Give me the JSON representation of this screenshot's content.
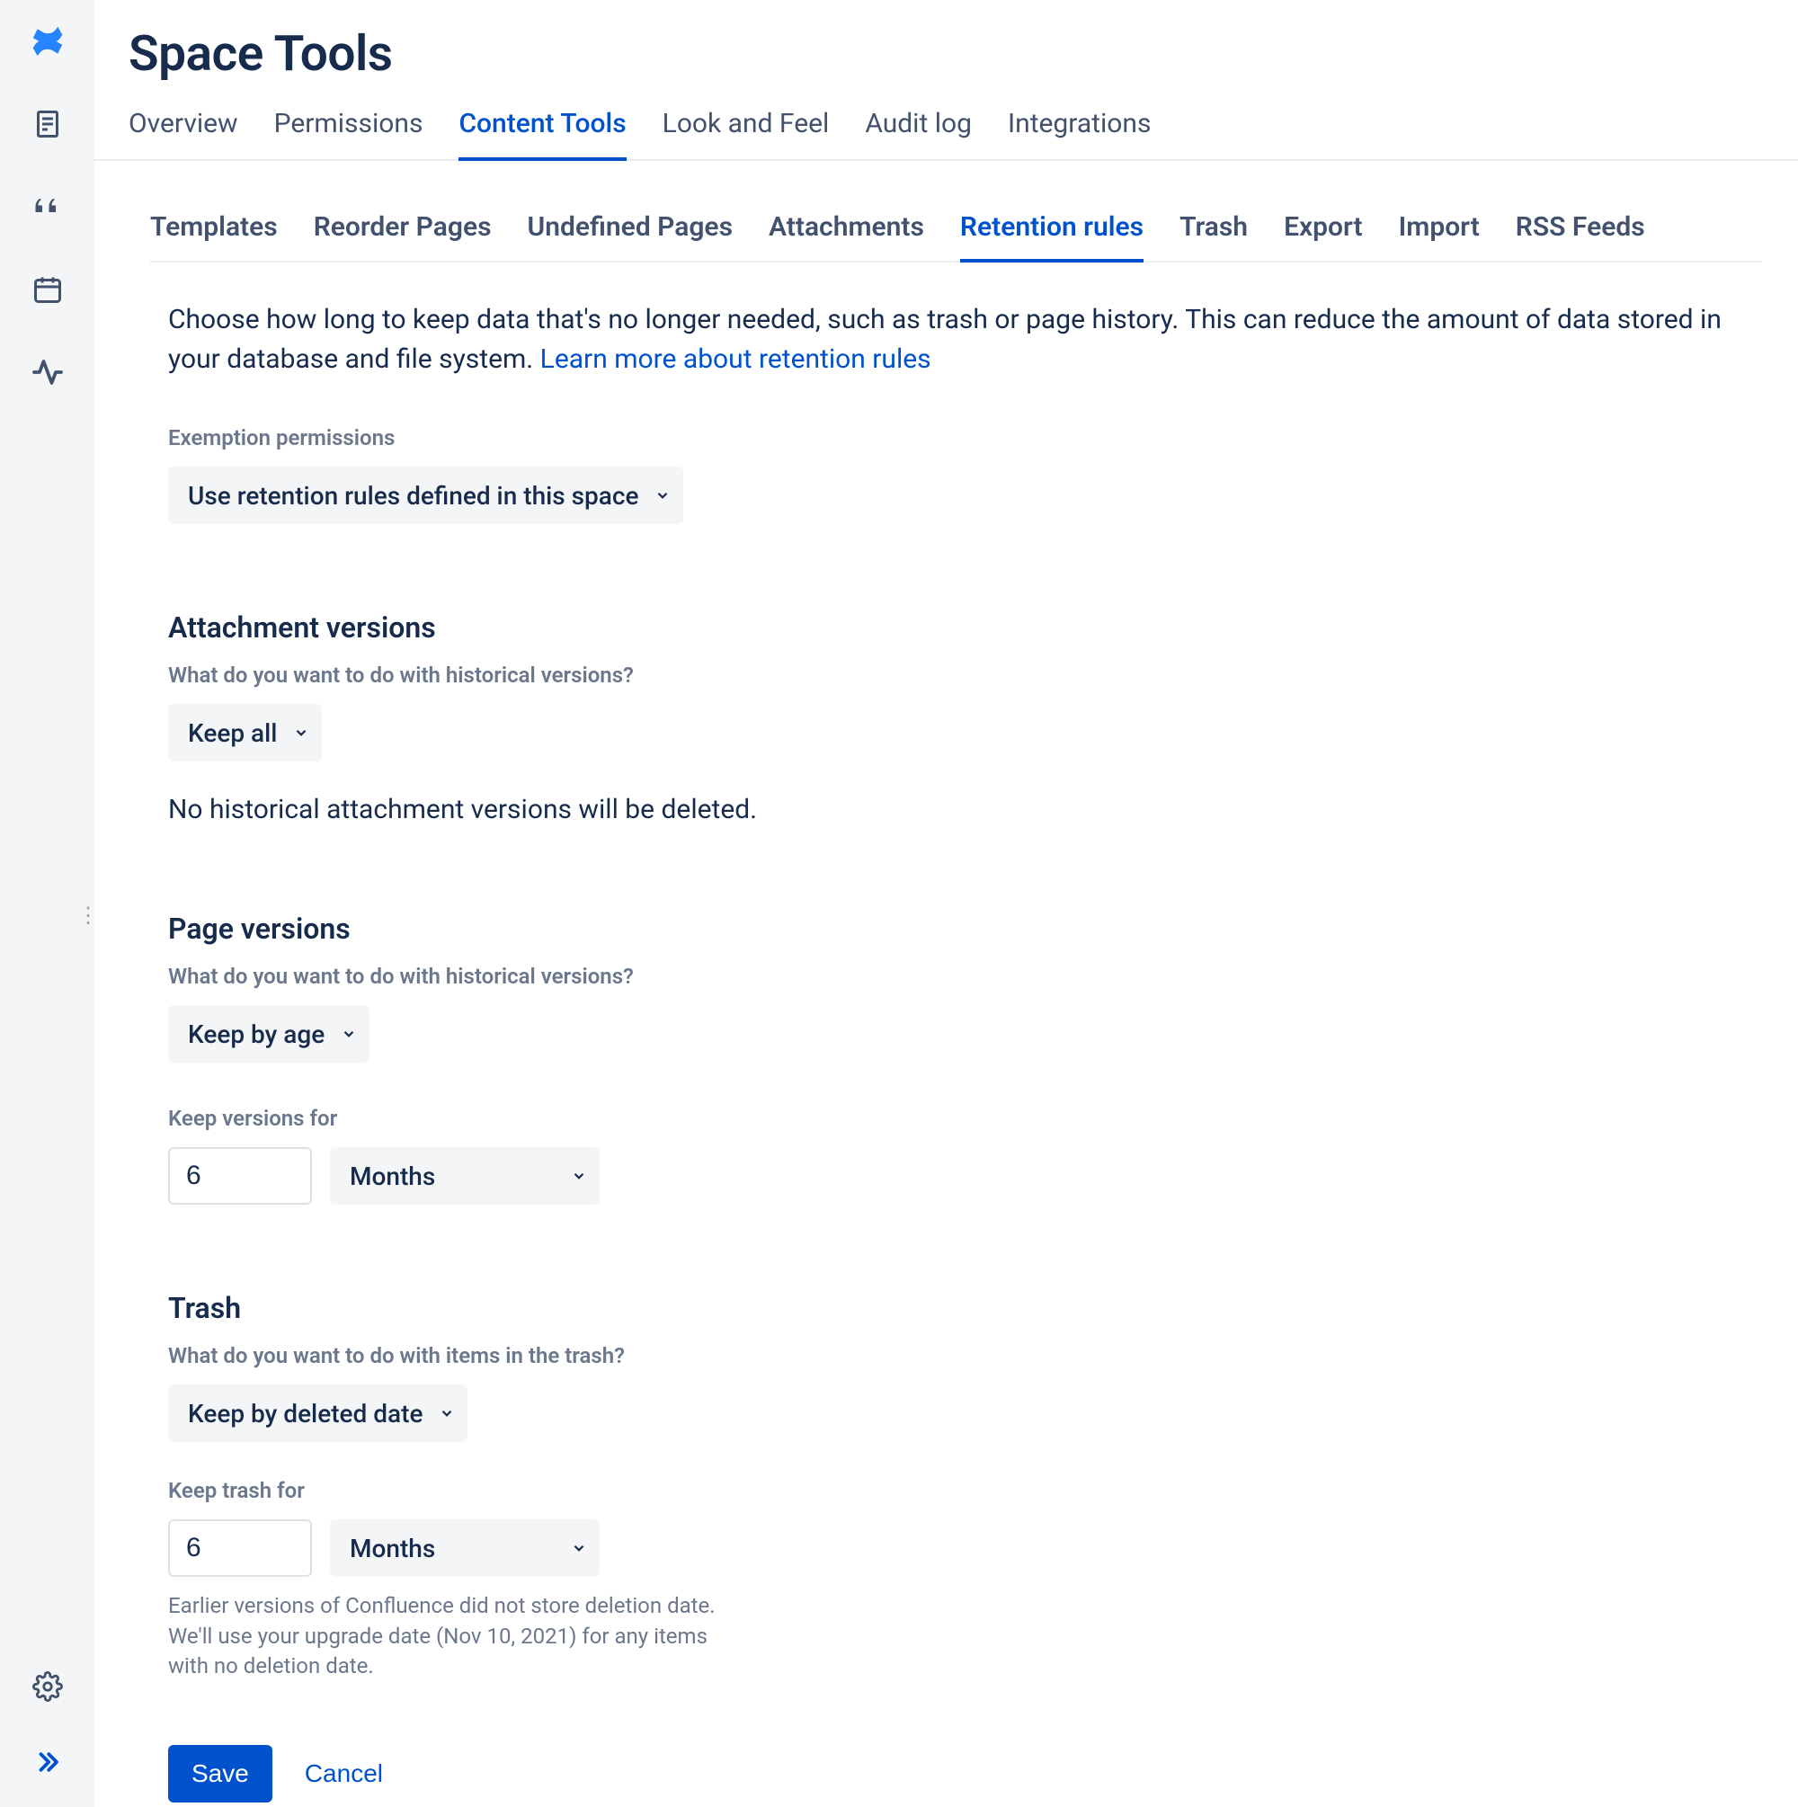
{
  "page": {
    "title": "Space Tools"
  },
  "topTabs": [
    {
      "label": "Overview"
    },
    {
      "label": "Permissions"
    },
    {
      "label": "Content Tools",
      "active": true
    },
    {
      "label": "Look and Feel"
    },
    {
      "label": "Audit log"
    },
    {
      "label": "Integrations"
    }
  ],
  "subTabs": [
    {
      "label": "Templates"
    },
    {
      "label": "Reorder Pages"
    },
    {
      "label": "Undefined Pages"
    },
    {
      "label": "Attachments"
    },
    {
      "label": "Retention rules",
      "active": true
    },
    {
      "label": "Trash"
    },
    {
      "label": "Export"
    },
    {
      "label": "Import"
    },
    {
      "label": "RSS Feeds"
    }
  ],
  "intro": {
    "text": "Choose how long to keep data that's no longer needed, such as trash or page history. This can reduce the amount of data stored in your database and file system. ",
    "linkText": "Learn more about retention rules"
  },
  "exemption": {
    "label": "Exemption permissions",
    "value": "Use retention rules defined in this space"
  },
  "attachment": {
    "title": "Attachment versions",
    "question": "What do you want to do with historical versions?",
    "mode": "Keep all",
    "hint": "No historical attachment versions will be deleted."
  },
  "pageVersions": {
    "title": "Page versions",
    "question": "What do you want to do with historical versions?",
    "mode": "Keep by age",
    "keepForLabel": "Keep versions for",
    "keepForValue": "6",
    "keepForUnit": "Months"
  },
  "trash": {
    "title": "Trash",
    "question": "What do you want to do with items in the trash?",
    "mode": "Keep by deleted date",
    "keepForLabel": "Keep trash for",
    "keepForValue": "6",
    "keepForUnit": "Months",
    "footnote": "Earlier versions of Confluence did not store deletion date. We'll use your upgrade date (Nov 10, 2021) for any items with no deletion date."
  },
  "actions": {
    "save": "Save",
    "cancel": "Cancel"
  }
}
